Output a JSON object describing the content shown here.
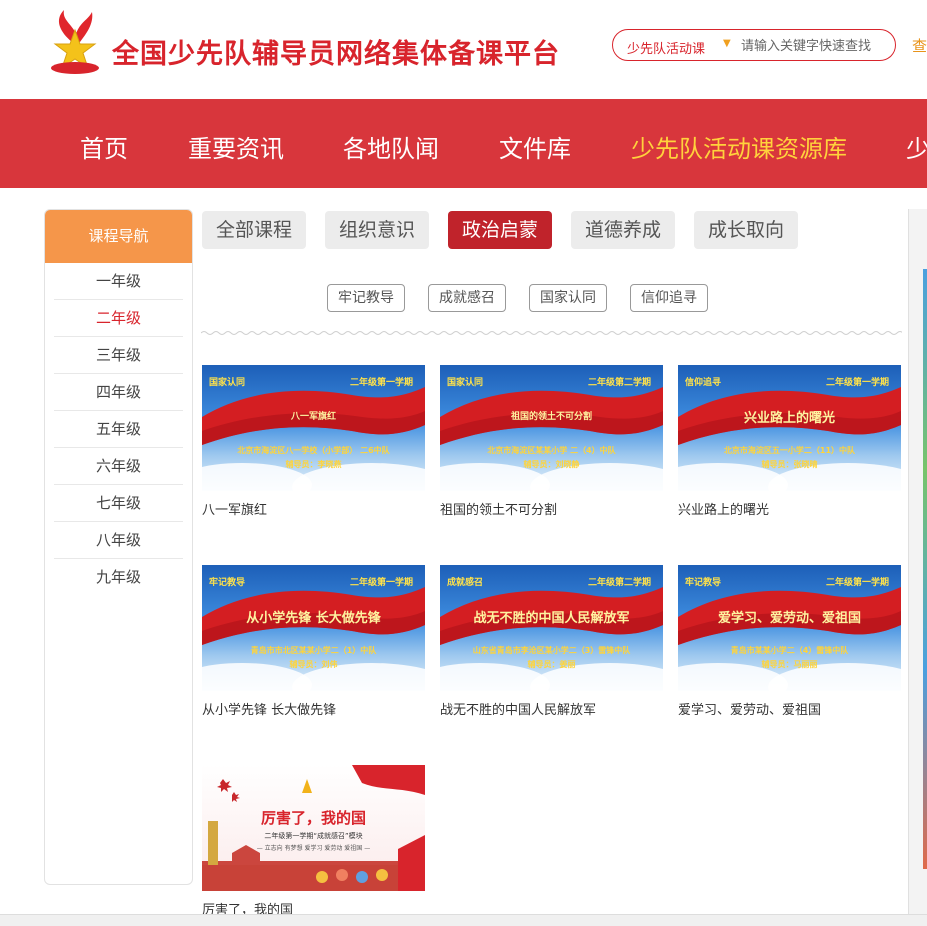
{
  "header": {
    "logo_name": "shaoxiandui-badge-logo",
    "site_title": "全国少先队辅导员网络集体备课平台",
    "search_category": "少先队活动课",
    "search_placeholder": "请输入关键字快速查找",
    "search_button": "查"
  },
  "nav": {
    "items": [
      {
        "label": "首页"
      },
      {
        "label": "重要资讯"
      },
      {
        "label": "各地队闻"
      },
      {
        "label": "文件库"
      },
      {
        "label": "少先队活动课资源库"
      },
      {
        "label": "少"
      }
    ],
    "active_index": 4
  },
  "sidebar": {
    "title": "课程导航",
    "grades": [
      "一年级",
      "二年级",
      "三年级",
      "四年级",
      "五年级",
      "六年级",
      "七年级",
      "八年级",
      "九年级"
    ],
    "active_index": 1
  },
  "tabs": {
    "items": [
      "全部课程",
      "组织意识",
      "政治启蒙",
      "道德养成",
      "成长取向"
    ],
    "active_index": 2
  },
  "subtabs": [
    "牢记教导",
    "成就感召",
    "国家认同",
    "信仰追寻"
  ],
  "cards": [
    {
      "category": "国家认同",
      "term": "二年级第一学期",
      "thumb_title": "八一军旗红",
      "school": "北京市海淀区八一学校（小学部） 二6中队",
      "teacher": "辅导员：李晓燕",
      "caption": "八一军旗红"
    },
    {
      "category": "国家认同",
      "term": "二年级第二学期",
      "thumb_title": "祖国的领土不可分割",
      "school": "北京市海淀区某某小学 二（4）中队",
      "teacher": "辅导员：刘晓静",
      "caption": "祖国的领土不可分割"
    },
    {
      "category": "信仰追寻",
      "term": "二年级第一学期",
      "thumb_title": "兴业路上的曙光",
      "school": "北京市海淀区五一小学二（11）中队",
      "teacher": "辅导员：张晓晴",
      "caption": "兴业路上的曙光"
    },
    {
      "category": "牢记教导",
      "term": "二年级第一学期",
      "thumb_title": "从小学先锋 长大做先锋",
      "school": "青岛市市北区某某小学二（1）中队",
      "teacher": "辅导员：刘伟",
      "caption": "从小学先锋 长大做先锋"
    },
    {
      "category": "成就感召",
      "term": "二年级第二学期",
      "thumb_title": "战无不胜的中国人民解放军",
      "school": "山东省青岛市李沧区某小学二（3）雷锋中队",
      "teacher": "辅导员：姜丽",
      "caption": "战无不胜的中国人民解放军"
    },
    {
      "category": "牢记教导",
      "term": "二年级第一学期",
      "thumb_title": "爱学习、爱劳动、爱祖国",
      "school": "青岛市某某小学二（4）雷锋中队",
      "teacher": "辅导员：马丽丽",
      "caption": "爱学习、爱劳动、爱祖国"
    }
  ],
  "special_card": {
    "thumb_title": "厉害了，我的国",
    "thumb_sub": "二年级第一学期“成就感召”模块",
    "thumb_line": "— 立志向 有梦想 爱学习 爱劳动 爱祖国 —",
    "caption": "厉害了，我的国"
  },
  "colors": {
    "brand_red": "#d8242c",
    "nav_red": "#d8363c",
    "nav_active": "#ffd23c",
    "sidebar_head": "#f5964a",
    "tab_active": "#c0232b"
  }
}
